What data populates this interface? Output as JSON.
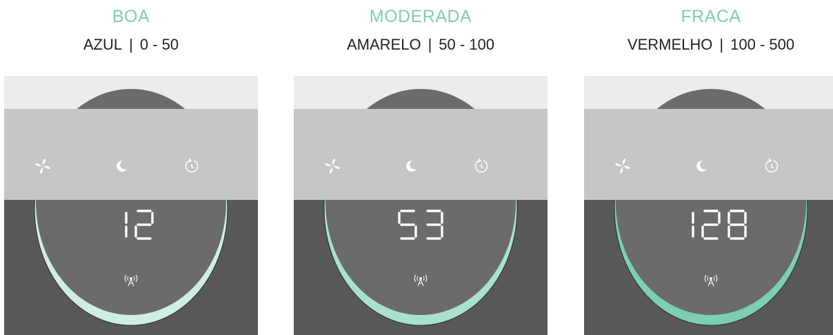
{
  "levels": [
    {
      "title": "BOA",
      "color_name": "AZUL",
      "range": "0 - 50",
      "reading": "12",
      "ring_color": "#cfeee3"
    },
    {
      "title": "MODERADA",
      "color_name": "AMARELO",
      "range": "50 - 100",
      "reading": "53",
      "ring_color": "#a9e1ce"
    },
    {
      "title": "FRACA",
      "color_name": "VERMELHO",
      "range": "100 - 500",
      "reading": "128",
      "ring_color": "#7ccfb3"
    }
  ],
  "separator": "|",
  "icons": [
    "fan-icon",
    "moon-icon",
    "timer-icon",
    "wifi-signal-icon"
  ]
}
